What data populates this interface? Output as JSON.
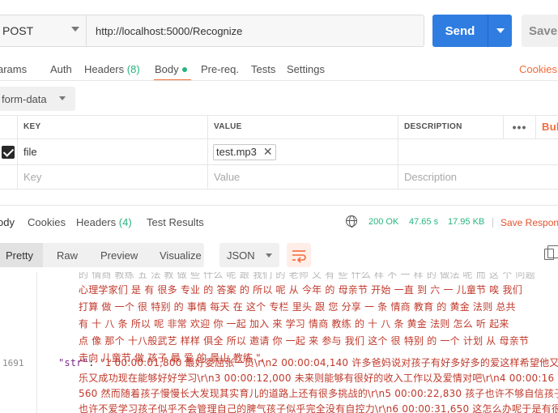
{
  "request": {
    "method": "POST",
    "url": "http://localhost:5000/Recognize",
    "send_label": "Send",
    "save_label": "Save"
  },
  "request_tabs": {
    "params": "arams",
    "auth": "Auth",
    "headers": "Headers",
    "headers_count": "(8)",
    "body": "Body",
    "prereq": "Pre-req.",
    "tests": "Tests",
    "settings": "Settings",
    "cookies": "Cookies"
  },
  "body_type": "form-data",
  "form_table": {
    "columns": [
      "KEY",
      "VALUE",
      "DESCRIPTION"
    ],
    "more": "•••",
    "bulk": "Bul",
    "rows": [
      {
        "key": "file",
        "value": "test.mp3",
        "checked": true
      }
    ],
    "placeholder": {
      "key": "Key",
      "value": "Value",
      "description": "Description"
    }
  },
  "response_tabs": {
    "body": "ody",
    "cookies": "Cookies",
    "headers": "Headers",
    "headers_count": "(4)",
    "test_results": "Test Results",
    "status": "200 OK",
    "time": "47.65 s",
    "size": "17.95 KB",
    "save_response": "Save Respon"
  },
  "response_view": {
    "pretty": "Pretty",
    "raw": "Raw",
    "preview": "Preview",
    "visualize": "Visualize",
    "format": "JSON"
  },
  "code": {
    "line_number": "1691",
    "lines": [
      "的 情商 教练 五 法 教 做 些 什么 呢 跟 我们 的 老师 又 有 些 什么 样 不 一 样 的 做法 呢 而 这 个 问题",
      "心理学家们 是 有 很多 专业 的 答案 的 所以 呢 从 今年 的 母亲节 开始 一直 到 六 一 儿童节 唉 我们",
      "打算 做 一个 很 特别 的 事情 每天 在 这个 专栏 里头 跟 您 分享 一 条 情商 教育 的 黄金 法则 总共",
      "有 十 八 条 所以 呢 非常 欢迎 你 一起 加入 来 学习 情商 教练 的 十 八 条 黄金 法则 怎么 听 起来",
      "点 像 那个 十八般武艺 样样 俱全 所以 邀请 你 一起 来 参与 我们 这个 很 特别 的 一个 计划 从 母亲节",
      "走向 儿童节 做 孩子 最 爱 的 景山 教练 \","
    ],
    "str_key": "\"str\"",
    "str_lines": [
      "\"1 00:00:01,800 最好委屈张一员\\r\\n2 00:00:04,140 许多爸妈说对孩子有好多好多的爱这样希望他又快",
      "乐又成功现在能够好好学习\\r\\n3 00:00:12,000 未来则能够有很好的收入工作以及爱情对吧\\r\\n4 00:00:16",
      "560 然而随着孩子慢慢长大发现其实育儿的道路上还有很多挑战的\\r\\n5 00:00:22,830 孩子也许不够自信孩子",
      "也许不爱学习孩子似乎不会管理自己的脾气孩子似乎完全没有自控力\\r\\n6 00:00:31,650 这怎么办呢于是有很"
    ]
  },
  "colors": {
    "accent": "#f26b3a",
    "send": "#2f7de1",
    "success": "#26b47f"
  }
}
